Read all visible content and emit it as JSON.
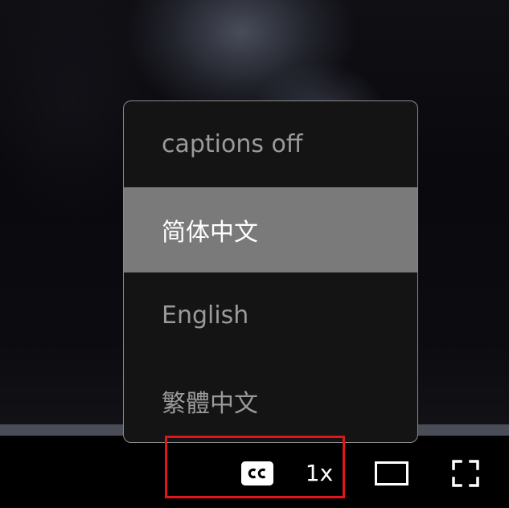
{
  "captions_menu": {
    "items": [
      {
        "label": "captions off",
        "selected": false
      },
      {
        "label": "简体中文",
        "selected": true
      },
      {
        "label": "English",
        "selected": false
      },
      {
        "label": "繁體中文",
        "selected": false
      }
    ]
  },
  "controls": {
    "cc_icon": "closed-captions-icon",
    "speed_label": "1x",
    "theater_icon": "theater-mode-icon",
    "fullscreen_icon": "fullscreen-icon"
  },
  "colors": {
    "menu_background": "#141414",
    "menu_selected": "#7a7a7a",
    "menu_border": "#8a8a8a",
    "progress_track": "#4a4c57",
    "highlight": "#e0161b"
  }
}
